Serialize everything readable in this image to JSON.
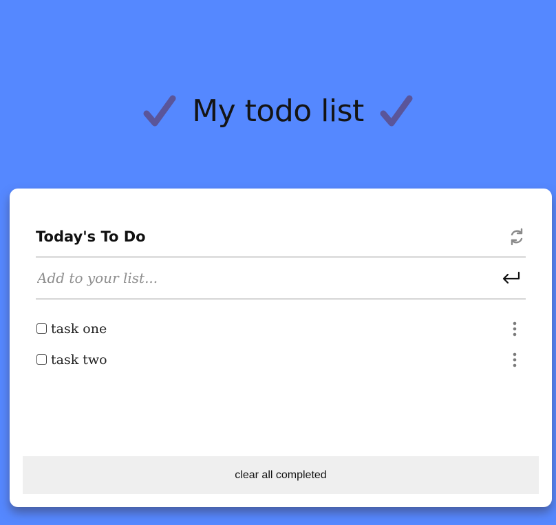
{
  "app": {
    "title": "My todo list",
    "title_icon": "check-mark-icon",
    "accent_color": "#5588ff",
    "check_color": "#5a559a"
  },
  "card": {
    "title": "Today's To Do",
    "refresh_icon": "refresh-icon"
  },
  "add_task": {
    "value": "",
    "placeholder": "Add to your list...",
    "submit_icon": "enter-return-icon"
  },
  "tasks": [
    {
      "label": "task one",
      "checked": false,
      "menu_icon": "kebab-menu-icon"
    },
    {
      "label": "task two",
      "checked": false,
      "menu_icon": "kebab-menu-icon"
    }
  ],
  "footer": {
    "clear_label": "clear all completed"
  }
}
